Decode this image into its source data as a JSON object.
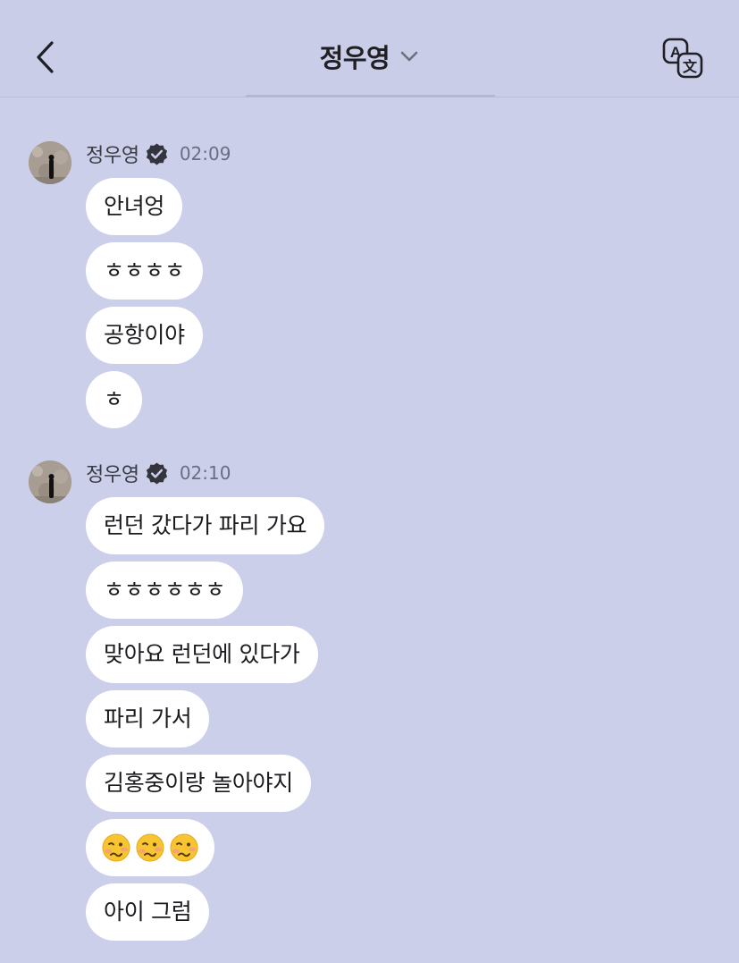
{
  "header": {
    "title": "정우영",
    "back_icon": "chevron-left-icon",
    "dropdown_icon": "chevron-down-icon",
    "translate_icon": "translate-icon"
  },
  "groups": [
    {
      "sender": "정우영",
      "time": "02:09",
      "verified_icon": "verified-badge-icon",
      "messages": [
        "안녀엉",
        "ㅎㅎㅎㅎ",
        "공항이야",
        "ㅎ"
      ]
    },
    {
      "sender": "정우영",
      "time": "02:10",
      "verified_icon": "verified-badge-icon",
      "messages": [
        "런던 갔다가 파리 가요",
        "ㅎㅎㅎㅎㅎㅎ",
        "맞아요 런던에 있다가",
        "파리 가서",
        "김홍중이랑 놀아야지"
      ],
      "emoji_message": {
        "emoji": "woozy-face",
        "count": 3
      },
      "last_message": "아이 그럼"
    }
  ],
  "colors": {
    "background": "#cbcfe9",
    "bubble": "#ffffff",
    "badge": "#34343d"
  }
}
